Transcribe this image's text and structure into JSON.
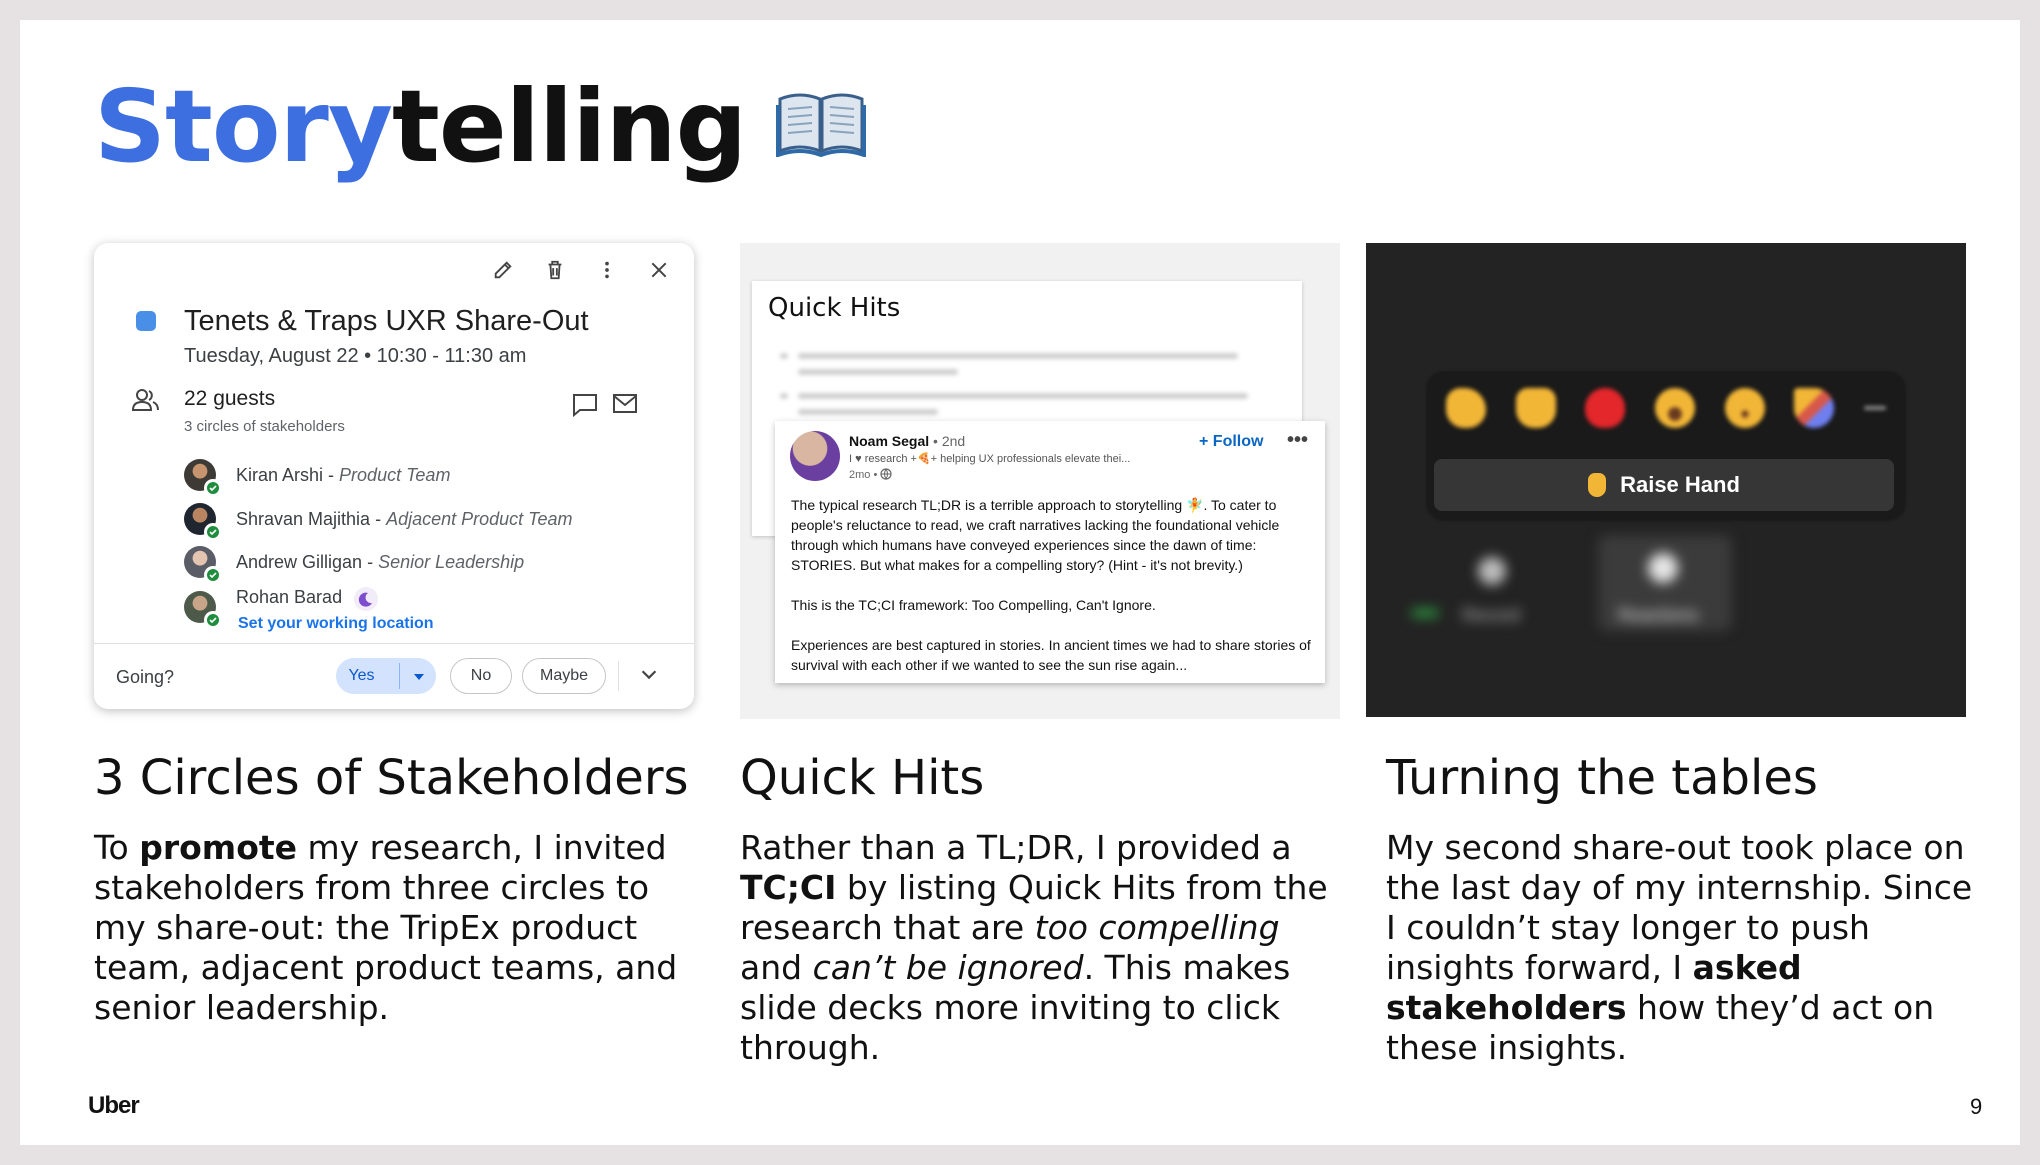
{
  "slide": {
    "title_blue": "Story",
    "title_black": "telling",
    "title_icon": "open-book-icon",
    "logo": "Uber",
    "page_number": "9"
  },
  "calendar": {
    "event_title": "Tenets & Traps UXR Share-Out",
    "event_time": "Tuesday, August 22 • 10:30 - 11:30 am",
    "event_color": "#4a8fe7",
    "guests_count": "22 guests",
    "guests_sub": "3 circles of stakeholders",
    "guests": [
      {
        "name": "Kiran Arshi",
        "role": "Product Team"
      },
      {
        "name": "Shravan Majithia",
        "role": "Adjacent Product Team"
      },
      {
        "name": "Andrew Gilligan",
        "role": "Senior Leadership"
      },
      {
        "name": "Rohan Barad",
        "role": ""
      }
    ],
    "set_location": "Set your working location",
    "going_label": "Going?",
    "yes": "Yes",
    "no": "No",
    "maybe": "Maybe"
  },
  "quick_hits": {
    "doc_title": "Quick Hits",
    "post": {
      "author": "Noam Segal",
      "degree": "• 2nd",
      "headline": "I ♥ research +🍕+ helping UX professionals elevate thei...",
      "time": "2mo •",
      "follow": "+ Follow",
      "p1": "The typical research TL;DR is a terrible approach to storytelling 🧚. To cater to people's reluctance to read, we craft narratives lacking the foundational vehicle through which humans have conveyed experiences since the dawn of time: STORIES. But what makes for a compelling story? (Hint - it's not brevity.)",
      "p2": "This is the TC;CI framework: Too Compelling, Can't Ignore.",
      "p3": "Experiences are best captured in stories. In ancient times we had to share stories of survival with each other if we wanted to see the sun rise again..."
    }
  },
  "zoom": {
    "raise_hand": "Raise Hand",
    "record": "Record",
    "reactions": "Reactions"
  },
  "columns": [
    {
      "heading": "3 Circles of Stakeholders",
      "t1": "To ",
      "b1": "promote",
      "t2": " my research, I invited stakeholders from three circles to my share-out: the TripEx product team, adjacent product teams, and senior leadership."
    },
    {
      "heading": "Quick Hits",
      "t1": "Rather than a TL;DR, I provided a ",
      "b1": "TC;CI",
      "t2": " by listing Quick Hits from the research that are ",
      "i1": "too compelling",
      "t3": " and ",
      "i2": "can’t be ignored",
      "t4": ". This makes slide decks more inviting to click through."
    },
    {
      "heading": "Turning the tables",
      "t1": "My second share-out took place on the last day of my internship. Since I couldn’t stay longer to push insights forward, I ",
      "b1": "asked stakeholders",
      "t2": " how they’d act on these insights."
    }
  ]
}
